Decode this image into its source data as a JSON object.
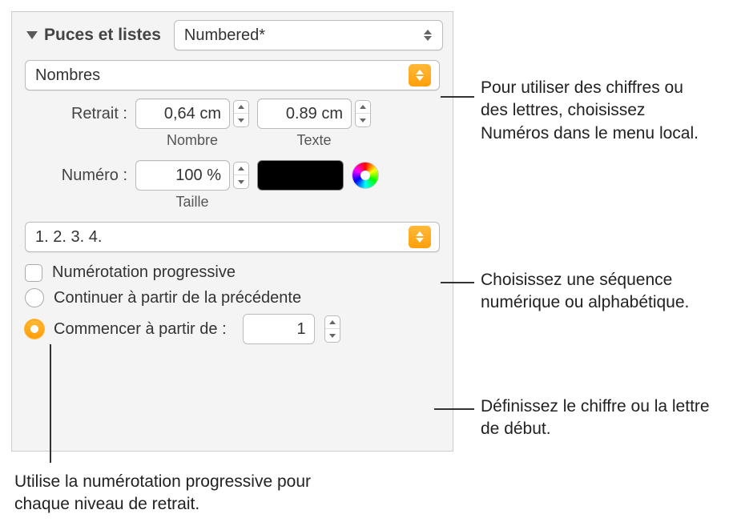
{
  "section": {
    "title": "Puces et listes",
    "listStyle": "Numbered*",
    "markerType": "Nombres"
  },
  "indent": {
    "label": "Retrait :",
    "numberValue": "0,64 cm",
    "numberSub": "Nombre",
    "textValue": "0.89 cm",
    "textSub": "Texte"
  },
  "number": {
    "label": "Numéro :",
    "sizeValue": "100 %",
    "sizeSub": "Taille"
  },
  "sequence": {
    "value": "1. 2. 3. 4."
  },
  "options": {
    "progressive": "Numérotation progressive",
    "continue": "Continuer à partir de la précédente",
    "startFrom": "Commencer à partir de :",
    "startValue": "1"
  },
  "callouts": {
    "c1": "Pour utiliser des chiffres ou des lettres, choisissez Numéros dans le menu local.",
    "c2": "Choisissez une séquence numérique ou alphabétique.",
    "c3": "Définissez le chiffre ou la lettre de début.",
    "c4": "Utilise la numérotation progressive pour chaque niveau de retrait."
  }
}
